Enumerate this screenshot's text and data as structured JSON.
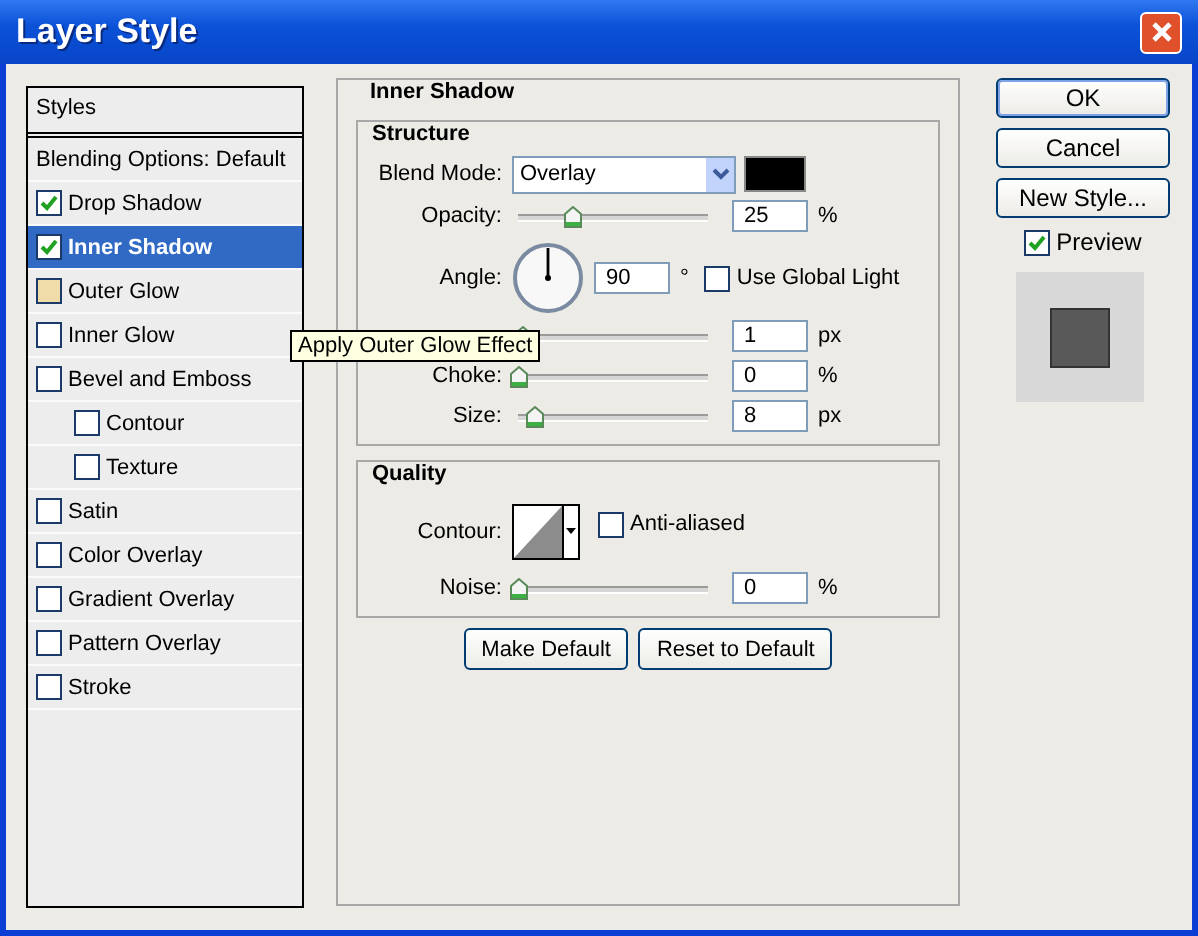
{
  "window": {
    "title": "Layer Style"
  },
  "styles_panel": {
    "header": "Styles",
    "items": [
      {
        "kind": "plain",
        "label": "Blending Options: Default",
        "selected": false
      },
      {
        "kind": "check",
        "label": "Drop Shadow",
        "checked": true,
        "selected": false,
        "hovered": false
      },
      {
        "kind": "check",
        "label": "Inner Shadow",
        "checked": true,
        "selected": true,
        "hovered": false
      },
      {
        "kind": "check",
        "label": "Outer Glow",
        "checked": false,
        "selected": false,
        "hovered": true
      },
      {
        "kind": "check",
        "label": "Inner Glow",
        "checked": false,
        "selected": false,
        "hovered": false
      },
      {
        "kind": "check",
        "label": "Bevel and Emboss",
        "checked": false,
        "selected": false,
        "hovered": false,
        "children": [
          {
            "kind": "check",
            "label": "Contour",
            "checked": false,
            "selected": false,
            "hovered": false
          },
          {
            "kind": "check",
            "label": "Texture",
            "checked": false,
            "selected": false,
            "hovered": false
          }
        ]
      },
      {
        "kind": "check",
        "label": "Satin",
        "checked": false,
        "selected": false,
        "hovered": false
      },
      {
        "kind": "check",
        "label": "Color Overlay",
        "checked": false,
        "selected": false,
        "hovered": false
      },
      {
        "kind": "check",
        "label": "Gradient Overlay",
        "checked": false,
        "selected": false,
        "hovered": false
      },
      {
        "kind": "check",
        "label": "Pattern Overlay",
        "checked": false,
        "selected": false,
        "hovered": false
      },
      {
        "kind": "check",
        "label": "Stroke",
        "checked": false,
        "selected": false,
        "hovered": false
      }
    ]
  },
  "tooltip": "Apply Outer Glow Effect",
  "inner_shadow": {
    "title": "Inner Shadow",
    "structure": {
      "title": "Structure",
      "rows": [
        {
          "kind": "dropdown",
          "label": "Blend Mode:",
          "value": "Overlay"
        },
        {
          "kind": "slider",
          "label": "Opacity:",
          "level": 0.26,
          "value": "25",
          "unit": "%"
        },
        {
          "kind": "angle",
          "label": "Angle:",
          "value": "90",
          "unit": "°",
          "global_light": {
            "label": "Use Global Light",
            "checked": false
          }
        },
        {
          "kind": "slider",
          "level": 0.02,
          "value": "1",
          "unit": "px"
        },
        {
          "kind": "slider",
          "label": "Choke:",
          "level": 0.0,
          "value": "0",
          "unit": "%"
        },
        {
          "kind": "slider",
          "label": "Size:",
          "level": 0.08,
          "value": "8",
          "unit": "px"
        }
      ]
    },
    "quality": {
      "title": "Quality",
      "contour_label": "Contour:",
      "anti_aliased": {
        "label": "Anti-aliased",
        "checked": false
      },
      "noise": {
        "label": "Noise:",
        "level": 0.0,
        "value": "0",
        "unit": "%"
      }
    },
    "buttons": [
      "Make Default",
      "Reset to Default"
    ]
  },
  "actions": [
    {
      "label": "OK",
      "default": true
    },
    {
      "label": "Cancel",
      "default": false
    },
    {
      "label": "New Style...",
      "default": false
    }
  ],
  "preview": {
    "label": "Preview",
    "checked": true
  }
}
